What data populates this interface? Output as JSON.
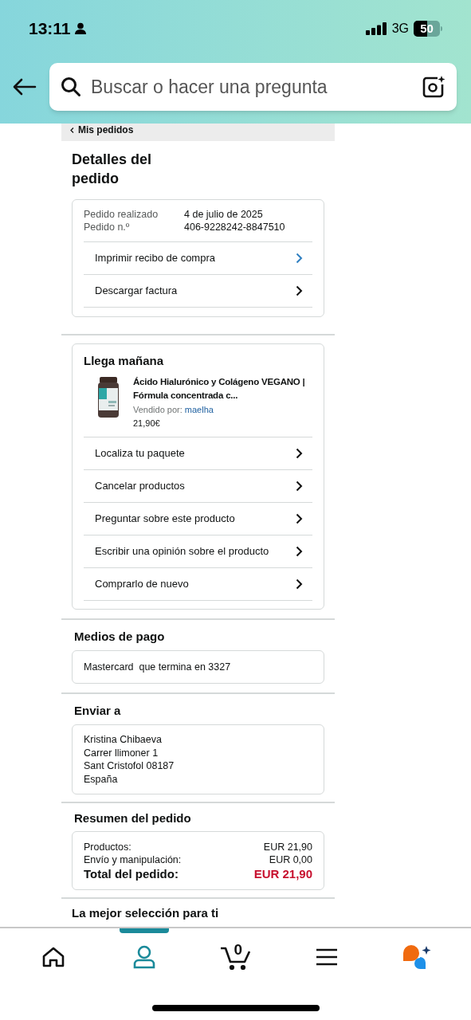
{
  "status_bar": {
    "time": "13:11",
    "network": "3G",
    "battery": "50"
  },
  "search": {
    "placeholder": "Buscar o hacer una pregunta"
  },
  "breadcrumb": "Mis pedidos",
  "title": "Detalles del pedido",
  "order_info": {
    "rows": [
      {
        "label": "Pedido realizado",
        "value": "4 de julio de 2025"
      },
      {
        "label": "Pedido n.º",
        "value": "406-9228242-8847510"
      }
    ],
    "actions": [
      {
        "label": "Imprimir recibo de compra",
        "kind": "link"
      },
      {
        "label": "Descargar factura",
        "kind": "plain"
      }
    ]
  },
  "delivery": {
    "heading": "Llega mañana",
    "product": {
      "title": "Ácido Hialurónico y Colágeno VEGANO | Fórmula concentrada c...",
      "sold_by_label": "Vendido por:",
      "seller": "maelha",
      "price": "21,90€"
    },
    "actions": [
      {
        "label": "Localiza tu paquete",
        "kind": "plain"
      },
      {
        "label": "Cancelar productos",
        "kind": "plain"
      },
      {
        "label": "Preguntar sobre este producto",
        "kind": "plain"
      },
      {
        "label": "Escribir una opinión sobre el producto",
        "kind": "plain"
      },
      {
        "label": "Comprarlo de nuevo",
        "kind": "plain"
      }
    ]
  },
  "payment": {
    "heading": "Medios de pago",
    "method": "Mastercard  que termina en 3327"
  },
  "shipping": {
    "heading": "Enviar a",
    "lines": [
      "Kristina Chibaeva",
      "Carrer llimoner 1",
      "Sant Cristofol 08187",
      "España"
    ]
  },
  "summary": {
    "heading": "Resumen del pedido",
    "rows": [
      {
        "label": "Productos:",
        "value": "EUR 21,90",
        "kind": "line"
      },
      {
        "label": "Envío y manipulación:",
        "value": "EUR 0,00",
        "kind": "line"
      },
      {
        "label": "Total del pedido:",
        "value": "EUR 21,90",
        "kind": "total"
      }
    ]
  },
  "recommendations": {
    "heading": "La mejor selección para ti"
  },
  "nav": [
    {
      "kind": "home",
      "selected": false
    },
    {
      "kind": "account",
      "selected": true
    },
    {
      "kind": "cart",
      "count": "0",
      "selected": false
    },
    {
      "kind": "menu",
      "selected": false
    },
    {
      "kind": "assistant",
      "selected": false
    }
  ]
}
